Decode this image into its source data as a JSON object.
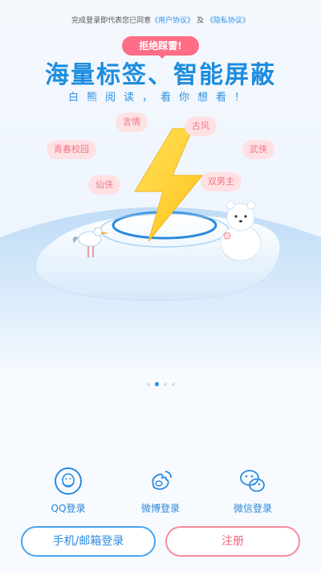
{
  "agreement": {
    "prefix": "完成登录即代表您已同意",
    "user_agreement": "《用户协议》",
    "and": " 及 ",
    "privacy_policy": "《隐私协议》"
  },
  "banner": "拒绝踩雷!",
  "headline": "海量标签、智能屏蔽",
  "subline": "白熊阅读，看你想看！",
  "tags": [
    "言情",
    "古风",
    "青春校园",
    "武侠",
    "仙侠",
    "双男主"
  ],
  "carousel": {
    "pages": 4,
    "active": 1
  },
  "login": {
    "qq": "QQ登录",
    "weibo": "微博登录",
    "wechat": "微信登录"
  },
  "buttons": {
    "phone_email": "手机/邮箱登录",
    "register": "注册"
  },
  "colors": {
    "accent_blue": "#2a8ae0",
    "accent_pink": "#f07786",
    "bolt_yellow": "#ffd23a"
  }
}
